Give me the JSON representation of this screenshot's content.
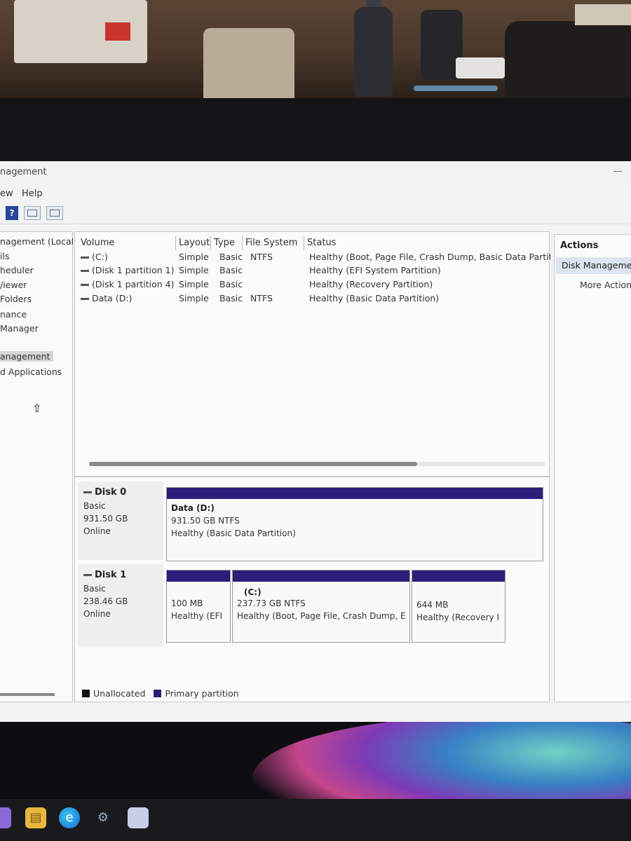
{
  "window": {
    "title": "nagement"
  },
  "menu": {
    "items": [
      "ew",
      "Help"
    ]
  },
  "tree": {
    "items": [
      "nagement (Local)",
      "ils",
      "heduler",
      "/iewer",
      "Folders",
      "nance",
      "Manager",
      "anagement",
      "d Applications"
    ],
    "selected_index": 7
  },
  "volume_list": {
    "columns": [
      "Volume",
      "Layout",
      "Type",
      "File System",
      "Status"
    ],
    "rows": [
      {
        "volume": "(C:)",
        "layout": "Simple",
        "type": "Basic",
        "fs": "NTFS",
        "status": "Healthy (Boot, Page File, Crash Dump, Basic Data Partitic"
      },
      {
        "volume": "(Disk 1 partition 1)",
        "layout": "Simple",
        "type": "Basic",
        "fs": "",
        "status": "Healthy (EFI System Partition)"
      },
      {
        "volume": "(Disk 1 partition 4)",
        "layout": "Simple",
        "type": "Basic",
        "fs": "",
        "status": "Healthy (Recovery Partition)"
      },
      {
        "volume": "Data (D:)",
        "layout": "Simple",
        "type": "Basic",
        "fs": "NTFS",
        "status": "Healthy (Basic Data Partition)"
      }
    ]
  },
  "disks": [
    {
      "name": "Disk 0",
      "kind": "Basic",
      "size": "931.50 GB",
      "state": "Online",
      "partitions": [
        {
          "label": "Data  (D:)",
          "size": "931.50 GB NTFS",
          "status": "Healthy (Basic Data Partition)"
        }
      ]
    },
    {
      "name": "Disk 1",
      "kind": "Basic",
      "size": "238.46 GB",
      "state": "Online",
      "partitions": [
        {
          "label": "",
          "size": "100 MB",
          "status": "Healthy (EFI"
        },
        {
          "label": "(C:)",
          "size": "237.73 GB NTFS",
          "status": "Healthy (Boot, Page File, Crash Dump, E"
        },
        {
          "label": "",
          "size": "644 MB",
          "status": "Healthy (Recovery I"
        }
      ]
    }
  ],
  "legend": {
    "unallocated": "Unallocated",
    "primary": "Primary partition"
  },
  "actions": {
    "header": "Actions",
    "selected": "Disk Manageme",
    "more": "More Action"
  },
  "colors": {
    "partition_bar": "#2c1f7a",
    "unallocated": "#111111"
  }
}
